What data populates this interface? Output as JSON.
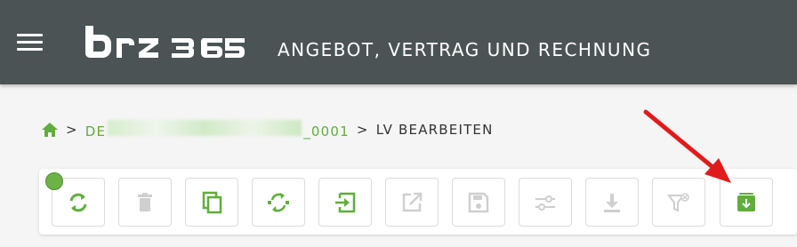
{
  "header": {
    "logo_text": "brz 365",
    "title": "ANGEBOT, VERTRAG UND RECHNUNG",
    "background": "#4b5355"
  },
  "breadcrumb": {
    "home_icon": "home-icon",
    "project_prefix": "DE",
    "project_suffix": "_0001",
    "separator": ">",
    "current": "LV BEARBEITEN"
  },
  "toolbar": {
    "active_color": "#5fae3b",
    "disabled_color": "#cfcfcf",
    "buttons": [
      {
        "icon": "sync-icon",
        "enabled": true
      },
      {
        "icon": "trash-icon",
        "enabled": false
      },
      {
        "icon": "copy-icon",
        "enabled": true
      },
      {
        "icon": "reorder-icon",
        "enabled": true
      },
      {
        "icon": "import-icon",
        "enabled": true
      },
      {
        "icon": "open-external-icon",
        "enabled": false
      },
      {
        "icon": "save-icon",
        "enabled": false
      },
      {
        "icon": "sliders-icon",
        "enabled": false
      },
      {
        "icon": "download-icon",
        "enabled": false
      },
      {
        "icon": "filter-clear-icon",
        "enabled": false
      },
      {
        "icon": "export-download-icon",
        "enabled": true,
        "highlighted": true
      }
    ]
  },
  "annotation": {
    "arrow_color": "#e01b1b"
  }
}
